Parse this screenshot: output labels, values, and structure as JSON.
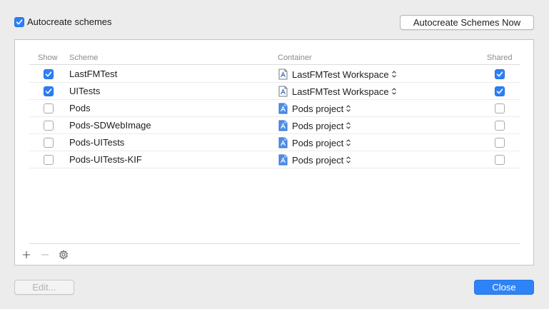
{
  "autocreate": {
    "label": "Autocreate schemes",
    "checked": true
  },
  "autocreate_now_button": "Autocreate Schemes Now",
  "table": {
    "headers": {
      "show": "Show",
      "scheme": "Scheme",
      "container": "Container",
      "shared": "Shared"
    },
    "rows": [
      {
        "show": true,
        "scheme": "LastFMTest",
        "container": "LastFMTest Workspace",
        "container_icon": "workspace-icon",
        "shared": true
      },
      {
        "show": true,
        "scheme": "UITests",
        "container": "LastFMTest Workspace",
        "container_icon": "workspace-icon",
        "shared": true
      },
      {
        "show": false,
        "scheme": "Pods",
        "container": "Pods project",
        "container_icon": "project-icon",
        "shared": false
      },
      {
        "show": false,
        "scheme": "Pods-SDWebImage",
        "container": "Pods project",
        "container_icon": "project-icon",
        "shared": false
      },
      {
        "show": false,
        "scheme": "Pods-UITests",
        "container": "Pods project",
        "container_icon": "project-icon",
        "shared": false
      },
      {
        "show": false,
        "scheme": "Pods-UITests-KIF",
        "container": "Pods project",
        "container_icon": "project-icon",
        "shared": false
      }
    ]
  },
  "toolbar": {
    "add_icon": "plus-icon",
    "remove_icon": "minus-icon",
    "gear_icon": "gear-icon"
  },
  "footer": {
    "edit_button": "Edit...",
    "close_button": "Close"
  },
  "colors": {
    "accent": "#2d7ff7",
    "background": "#ececec"
  }
}
